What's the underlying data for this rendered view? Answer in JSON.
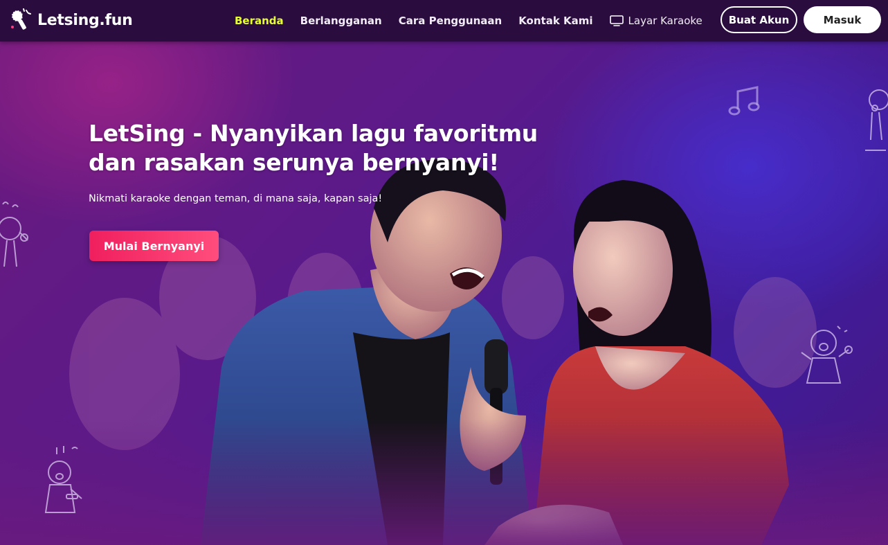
{
  "brand": {
    "name": "Letsing.fun"
  },
  "nav": {
    "items": [
      {
        "label": "Beranda",
        "active": true
      },
      {
        "label": "Berlangganan",
        "active": false
      },
      {
        "label": "Cara Penggunaan",
        "active": false
      },
      {
        "label": "Kontak Kami",
        "active": false
      },
      {
        "label": "Layar Karaoke",
        "active": false,
        "icon": "tv-icon"
      }
    ],
    "signup_label": "Buat Akun",
    "login_label": "Masuk"
  },
  "hero": {
    "title_line1": "LetSing - Nyanyikan lagu favoritmu",
    "title_line2": "dan rasakan serunya bernyanyi!",
    "subtitle": "Nikmati karaoke dengan teman, di mana saja, kapan saja!",
    "cta_label": "Mulai Bernyanyi"
  },
  "colors": {
    "nav_bg": "#2a0d3e",
    "active_link": "#e6ff2e",
    "cta": "#f01f5e",
    "hero_purple": "#5a1a8a"
  }
}
